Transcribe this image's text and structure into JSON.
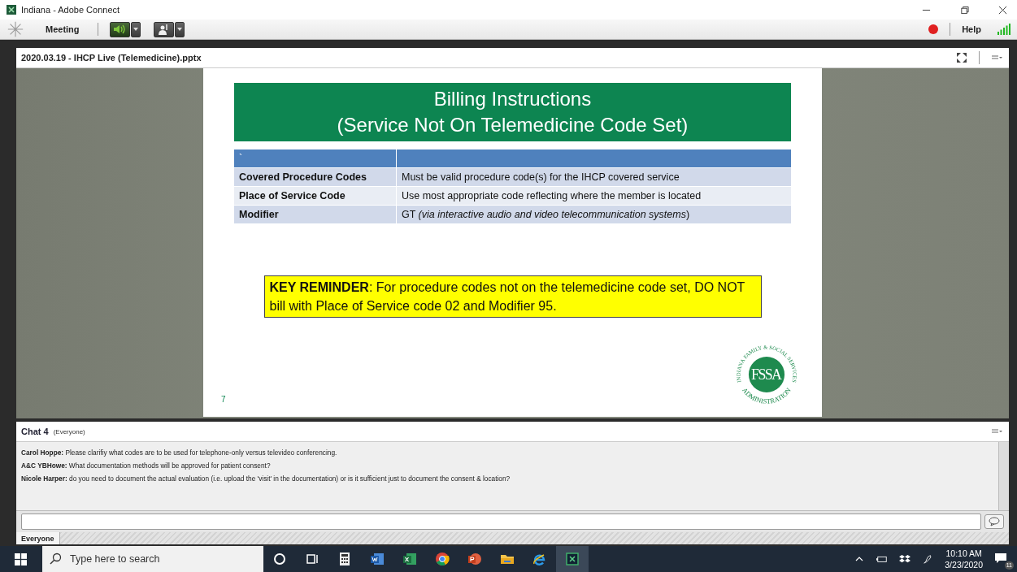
{
  "window": {
    "title": "Indiana - Adobe Connect"
  },
  "menu_bar": {
    "meeting": "Meeting",
    "help": "Help"
  },
  "share_pod": {
    "title": "2020.03.19 - IHCP Live (Telemedicine).pptx",
    "slide": {
      "title_lines": [
        "Billing Instructions",
        "(Service Not On Telemedicine Code Set)"
      ],
      "table": {
        "header": "`",
        "rows": [
          {
            "label": "Covered Procedure Codes",
            "value": "Must be valid procedure code(s) for the IHCP covered service"
          },
          {
            "label": "Place of Service Code",
            "value": "Use most appropriate code reflecting where the member is located"
          },
          {
            "label": "Modifier",
            "value": "GT *(via interactive audio and video telecommunication systems*)"
          }
        ]
      },
      "reminder": "**KEY REMINDER**: For procedure codes not on the telemedicine code set, DO NOT bill with Place of Service code 02 and Modifier 95.",
      "logo": {
        "monogram": "FSSA",
        "ring_text": "INDIANA FAMILY & SOCIAL SERVICES",
        "ring_bottom": "ADMINISTRATION"
      },
      "page_number": "7"
    }
  },
  "chat_pod": {
    "title": "Chat 4",
    "audience": "(Everyone)",
    "messages": [
      "**Carol Hoppe:** Please clarifiy what codes are to be used for telephone-only versus televideo conferencing.",
      "**A&C YBHowe:** What documentation methods will be approved for patient consent?",
      "**Nicole Harper:** do you need to document the actual evaluation (i.e. upload the 'visit' in the documentation) or is it sufficient just to document the consent & location?"
    ],
    "tabs": [
      {
        "label": "Everyone",
        "selected": true
      }
    ]
  },
  "taskbar": {
    "search": {
      "placeholder": "Type here to search"
    },
    "time": "10:10 AM",
    "date": "3/23/2020",
    "notifications": "11"
  }
}
